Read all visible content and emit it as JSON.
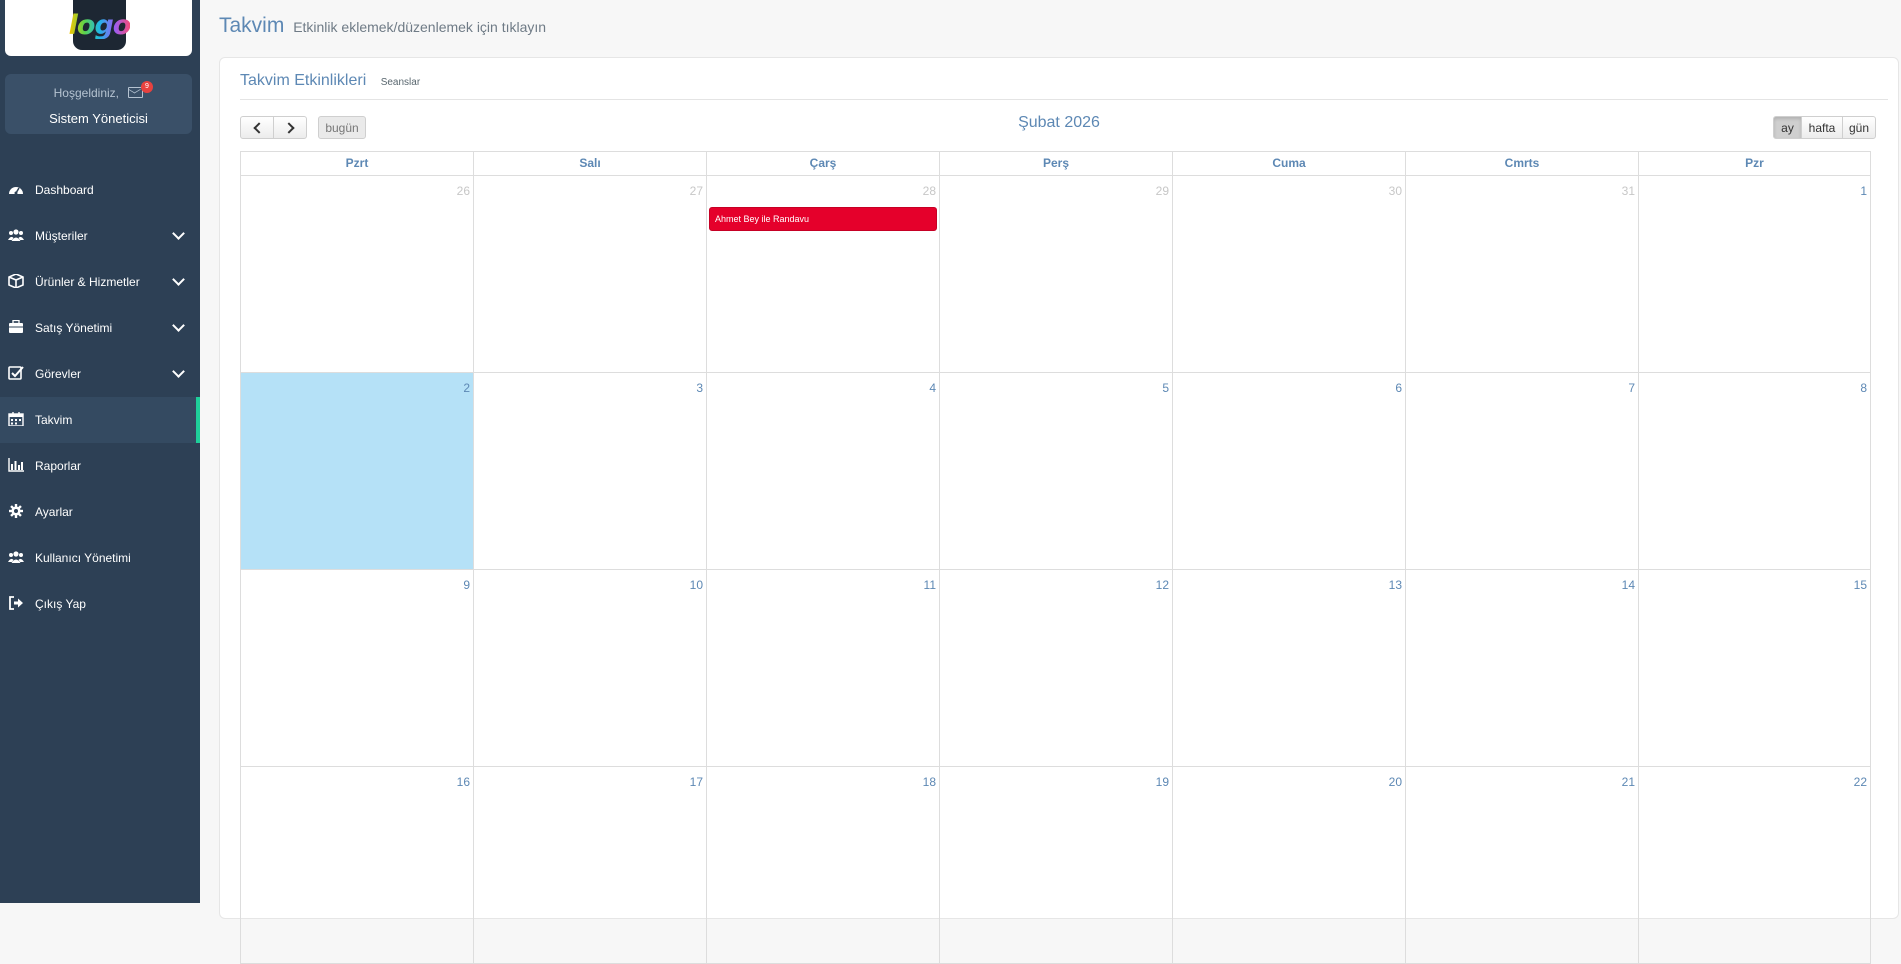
{
  "sidebar": {
    "logo_text": "logo",
    "welcome": "Hoşgeldiniz,",
    "badge_count": "9",
    "user_name": "Sistem Yöneticisi",
    "items": [
      {
        "label": "Dashboard",
        "icon": "dashboard-icon",
        "submenu": false,
        "active": false
      },
      {
        "label": "Müşteriler",
        "icon": "users-icon",
        "submenu": true,
        "active": false
      },
      {
        "label": "Ürünler & Hizmetler",
        "icon": "box-icon",
        "submenu": true,
        "active": false
      },
      {
        "label": "Satış Yönetimi",
        "icon": "briefcase-icon",
        "submenu": true,
        "active": false
      },
      {
        "label": "Görevler",
        "icon": "checkbox-icon",
        "submenu": true,
        "active": false
      },
      {
        "label": "Takvim",
        "icon": "calendar-icon",
        "submenu": false,
        "active": true
      },
      {
        "label": "Raporlar",
        "icon": "bar-chart-icon",
        "submenu": false,
        "active": false
      },
      {
        "label": "Ayarlar",
        "icon": "gear-icon",
        "submenu": false,
        "active": false
      },
      {
        "label": "Kullanıcı Yönetimi",
        "icon": "users-icon",
        "submenu": false,
        "active": false
      },
      {
        "label": "Çıkış Yap",
        "icon": "sign-out-icon",
        "submenu": false,
        "active": false
      }
    ]
  },
  "header": {
    "title": "Takvim",
    "subtitle": "Etkinlik eklemek/düzenlemek için tıklayın"
  },
  "panel": {
    "title": "Takvim Etkinlikleri",
    "tab": "Seanslar"
  },
  "calendar": {
    "today_label": "bugün",
    "month_title": "Şubat 2026",
    "views": {
      "month": "ay",
      "week": "hafta",
      "day": "gün"
    },
    "weekdays": [
      "Pzrt",
      "Salı",
      "Çarş",
      "Perş",
      "Cuma",
      "Cmrts",
      "Pzr"
    ],
    "weeks": [
      [
        {
          "d": "26",
          "other": true
        },
        {
          "d": "27",
          "other": true
        },
        {
          "d": "28",
          "other": true,
          "event": "Ahmet Bey ile Randavu"
        },
        {
          "d": "29",
          "other": true
        },
        {
          "d": "30",
          "other": true
        },
        {
          "d": "31",
          "other": true
        },
        {
          "d": "1"
        }
      ],
      [
        {
          "d": "2",
          "today": true
        },
        {
          "d": "3"
        },
        {
          "d": "4"
        },
        {
          "d": "5"
        },
        {
          "d": "6"
        },
        {
          "d": "7"
        },
        {
          "d": "8"
        }
      ],
      [
        {
          "d": "9"
        },
        {
          "d": "10"
        },
        {
          "d": "11"
        },
        {
          "d": "12"
        },
        {
          "d": "13"
        },
        {
          "d": "14"
        },
        {
          "d": "15"
        }
      ],
      [
        {
          "d": "16"
        },
        {
          "d": "17"
        },
        {
          "d": "18"
        },
        {
          "d": "19"
        },
        {
          "d": "20"
        },
        {
          "d": "21"
        },
        {
          "d": "22"
        }
      ]
    ]
  },
  "colors": {
    "sidebar": "#2d4055",
    "accent": "#1ecf9a",
    "event": "#e5002b",
    "today": "#b5e1f7"
  }
}
